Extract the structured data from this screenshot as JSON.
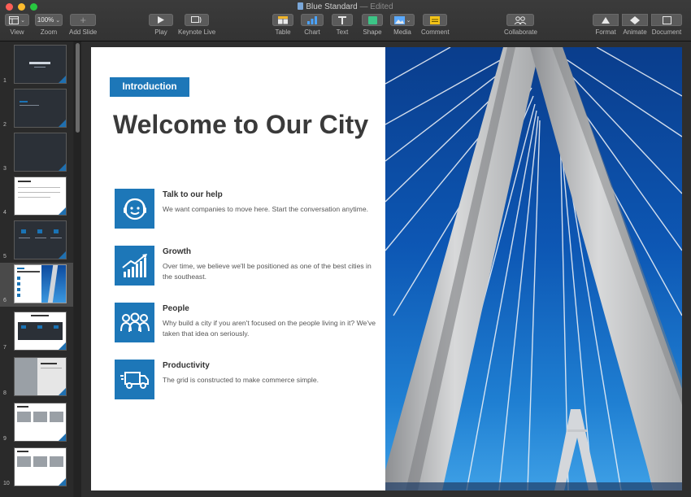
{
  "window": {
    "title": "Blue Standard",
    "status": "— Edited",
    "colors": {
      "close": "#fe5f57",
      "minimize": "#febc2e",
      "zoom": "#28c840"
    }
  },
  "toolbar": {
    "view_label": "View",
    "zoom_value": "100%",
    "zoom_label": "Zoom",
    "add_slide_label": "Add Slide",
    "play_label": "Play",
    "keynote_live_label": "Keynote Live",
    "table_label": "Table",
    "chart_label": "Chart",
    "text_label": "Text",
    "shape_label": "Shape",
    "media_label": "Media",
    "comment_label": "Comment",
    "collaborate_label": "Collaborate",
    "format_label": "Format",
    "animate_label": "Animate",
    "document_label": "Document"
  },
  "navigator": {
    "slides": [
      {
        "number": "1"
      },
      {
        "number": "2"
      },
      {
        "number": "3"
      },
      {
        "number": "4"
      },
      {
        "number": "5"
      },
      {
        "number": "6",
        "selected": true
      },
      {
        "number": "7"
      },
      {
        "number": "8"
      },
      {
        "number": "9"
      },
      {
        "number": "10"
      }
    ]
  },
  "slide": {
    "tag": "Introduction",
    "heading": "Welcome to Our City",
    "accent_color": "#1d77b8",
    "features": [
      {
        "icon": "headset-person-icon",
        "title": "Talk to our help",
        "body": "We want companies to move here. Start the conversation anytime."
      },
      {
        "icon": "growth-chart-icon",
        "title": "Growth",
        "body": "Over time, we believe we'll be positioned as one of the best cities in the southeast."
      },
      {
        "icon": "people-group-icon",
        "title": "People",
        "body": "Why build a city if you aren't focused on the people living in it? We've taken that idea on seriously."
      },
      {
        "icon": "delivery-truck-icon",
        "title": "Productivity",
        "body": "The grid is constructed to make commerce simple."
      }
    ]
  }
}
